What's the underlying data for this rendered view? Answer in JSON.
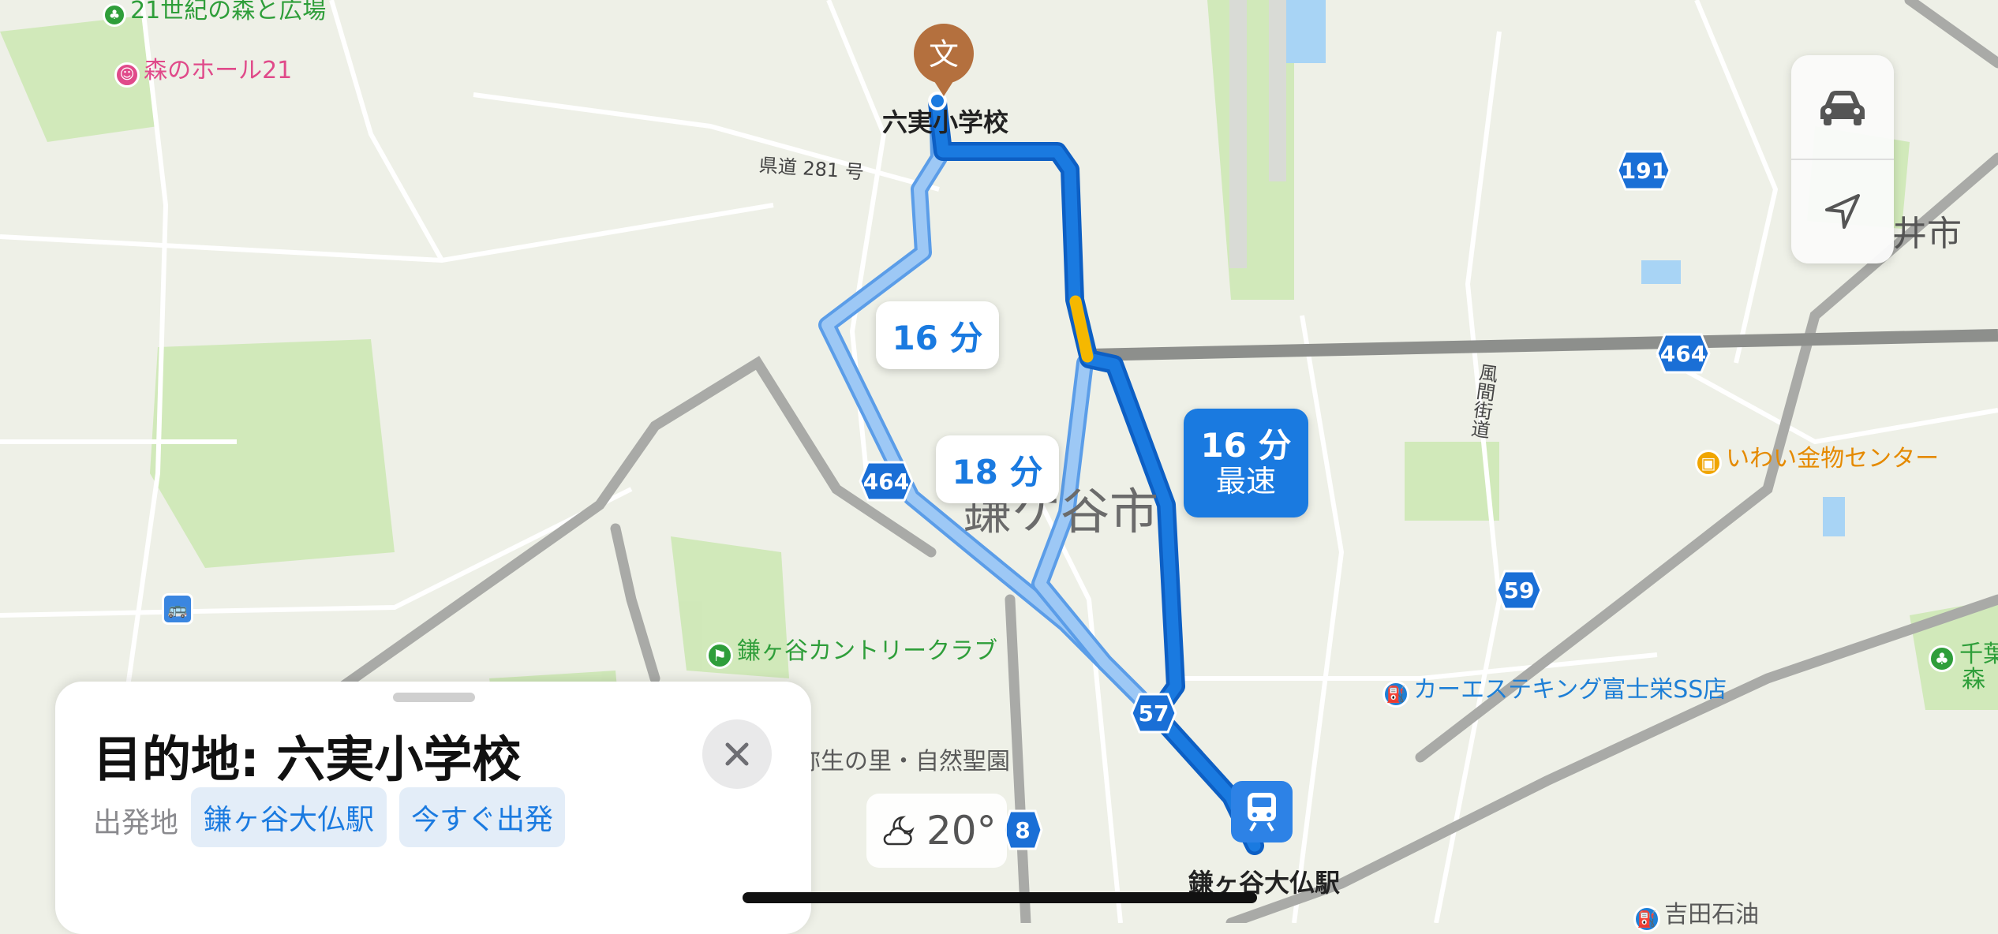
{
  "map": {
    "city_label": "鎌ケ谷市",
    "city_label_edge": "井市",
    "road_label_prefecture": "県道 281 号",
    "road_label_kazama": "風間街道",
    "places": [
      {
        "name": "21世紀の森と広場",
        "kind": "park"
      },
      {
        "name": "森のホール21",
        "kind": "theater"
      },
      {
        "name": "鎌ヶ谷カントリークラブ",
        "kind": "golf"
      },
      {
        "name": "弥生の里・自然聖園",
        "kind": "park"
      },
      {
        "name": "いわい金物センター",
        "kind": "shop"
      },
      {
        "name": "カーエステキング富士栄SS店",
        "kind": "gas"
      },
      {
        "name": "吉田石油",
        "kind": "gas"
      },
      {
        "name": "千葉",
        "kind": "park"
      },
      {
        "name": "森",
        "kind": "park"
      }
    ],
    "destination_label": "六実小学校",
    "destination_icon": "文",
    "origin_station_label": "鎌ヶ谷大仏駅",
    "highways": [
      "191",
      "464",
      "464",
      "59",
      "57",
      "8"
    ],
    "route_colors": {
      "primary": "#1a7ae0",
      "alternate": "#8ec0f5",
      "traffic": "#f5b800"
    }
  },
  "routes": [
    {
      "time": "16 分",
      "tag": "最速",
      "selected": true
    },
    {
      "time": "16 分",
      "tag": "",
      "selected": false
    },
    {
      "time": "18 分",
      "tag": "",
      "selected": false
    }
  ],
  "controls": {
    "drive_mode_icon": "car-icon",
    "locate_icon": "location-arrow-icon"
  },
  "weather": {
    "icon": "partly-cloudy-night-icon",
    "temperature": "20°"
  },
  "panel": {
    "title": "目的地: 六実小学校",
    "origin_label": "出発地",
    "origin_value": "鎌ヶ谷大仏駅",
    "departure_value": "今すぐ出発",
    "close_icon": "close-icon"
  }
}
